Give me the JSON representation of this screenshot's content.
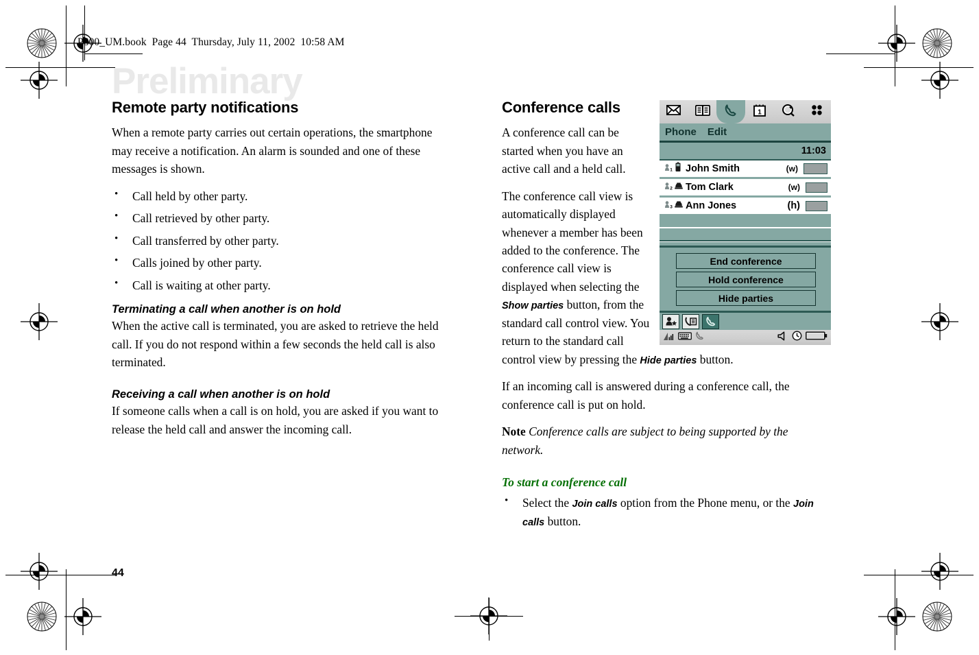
{
  "page": {
    "running_header": "P800_UM.book  Page 44  Thursday, July 11, 2002  10:58 AM",
    "watermark": "Preliminary",
    "folio": "44"
  },
  "left_column": {
    "heading": "Remote party notifications",
    "intro": "When a remote party carries out certain operations, the smartphone may receive a notification. An alarm is sounded and one of these messages is shown.",
    "bullets": [
      "Call held by other party.",
      "Call retrieved by other party.",
      "Call transferred by other party.",
      "Calls joined by other party.",
      "Call is waiting at other party."
    ],
    "sections": [
      {
        "heading": "Terminating a call when another is on hold",
        "body": "When the active call is terminated, you are asked to retrieve the held call. If you do not respond within a few seconds the held call is also terminated."
      },
      {
        "heading": "Receiving a call when another is on hold",
        "body": "If someone calls when a call is on hold, you are asked if you want to release the held call and answer the incoming call."
      }
    ]
  },
  "right_column": {
    "heading": "Conference calls",
    "para1": "A conference call can be started when you have an active call and a held call.",
    "para2_a": "The conference call view is automatically displayed whenever a member has been added to the conference. The conference call view is displayed when selecting the ",
    "para2_btn1": "Show parties",
    "para2_b": " button, from the standard call control view. You return to the standard call control view by pressing the ",
    "para2_btn2": "Hide parties",
    "para2_c": " button.",
    "para3": "If an incoming call is answered during a conference call, the conference call is put on hold.",
    "note_label": "Note",
    "note_text": "Conference calls are subject to being supported by the network.",
    "task_heading": "To start a conference call",
    "task_bullet_a": "Select the ",
    "task_bullet_btn1": "Join calls",
    "task_bullet_b": " option from the Phone menu, or the ",
    "task_bullet_btn2": "Join calls",
    "task_bullet_c": " button.",
    "green_color": "#067006"
  },
  "device": {
    "accent_color": "#85a8a3",
    "border_color": "#2d5a54",
    "tabs": [
      {
        "icon": "envelope-icon",
        "active": false
      },
      {
        "icon": "book-icon",
        "active": false
      },
      {
        "icon": "phone-handset-icon",
        "active": true
      },
      {
        "icon": "calendar-icon",
        "active": false
      },
      {
        "icon": "magnifier-icon",
        "active": false
      },
      {
        "icon": "apps-grid-icon",
        "active": false
      }
    ],
    "calendar_day": "1",
    "menus": [
      "Phone",
      "Edit"
    ],
    "clock": "11:03",
    "participants": [
      {
        "index": "1",
        "phone_icon": "mobile-phone-icon",
        "name": "John Smith",
        "tag": "(w)",
        "selected": true
      },
      {
        "index": "2",
        "phone_icon": "desk-phone-icon",
        "name": "Tom Clark",
        "tag": "(w)",
        "selected": false
      },
      {
        "index": "3",
        "phone_icon": "desk-phone-icon",
        "name": "Ann Jones",
        "tag": "(h)",
        "selected": false
      }
    ],
    "buttons": [
      "End conference",
      "Hold conference",
      "Hide parties"
    ],
    "app_icons": [
      {
        "icon": "new-contact-icon",
        "active": false
      },
      {
        "icon": "call-log-icon",
        "active": false
      },
      {
        "icon": "handset-icon",
        "active": true
      }
    ],
    "status_icons": [
      "signal-bars-icon",
      "keyboard-icon",
      "handset-small-icon",
      "speaker-icon",
      "clock-icon",
      "battery-icon"
    ]
  }
}
